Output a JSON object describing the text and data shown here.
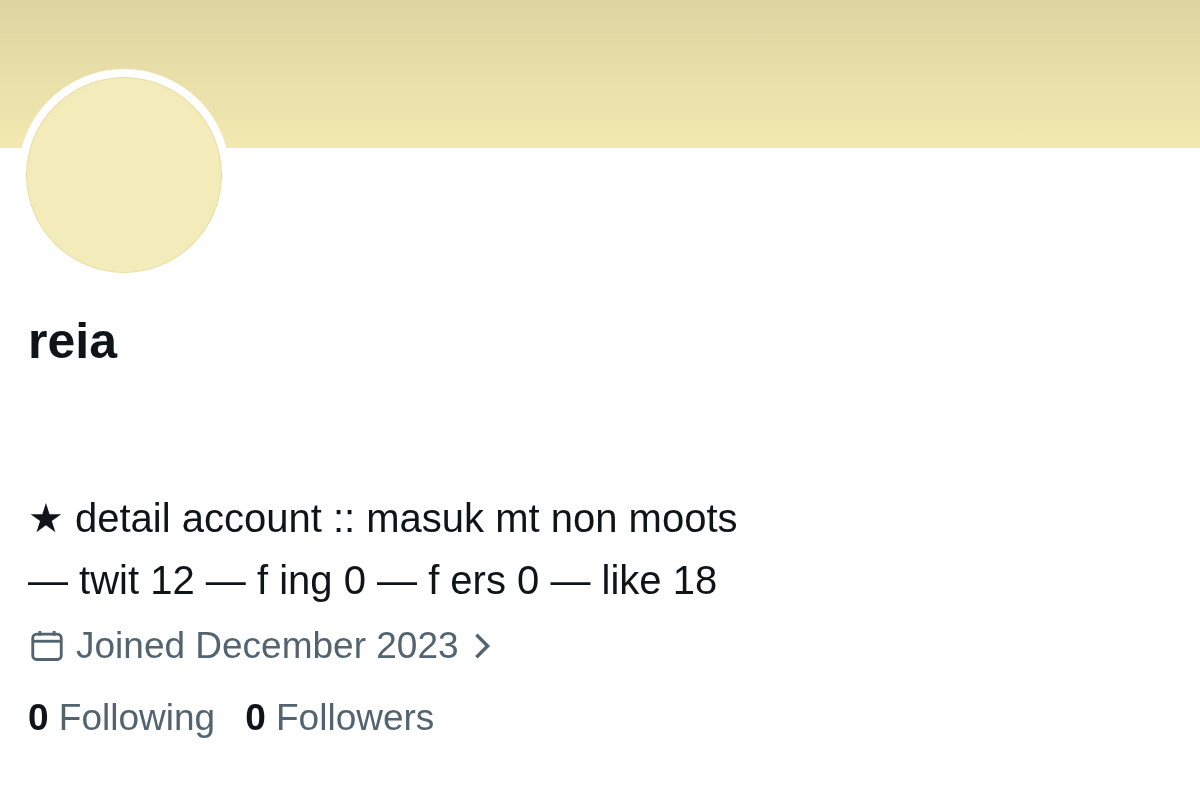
{
  "profile": {
    "name": "reia",
    "bio_lines": [
      "★ detail account :: masuk mt non moots",
      "— twit 12 — f ing 0 — f ers 0 — like 18"
    ],
    "joined": "Joined December 2023",
    "stats": [
      {
        "text": "**0** Following"
      },
      {
        "text": "**0** Followers"
      }
    ]
  }
}
